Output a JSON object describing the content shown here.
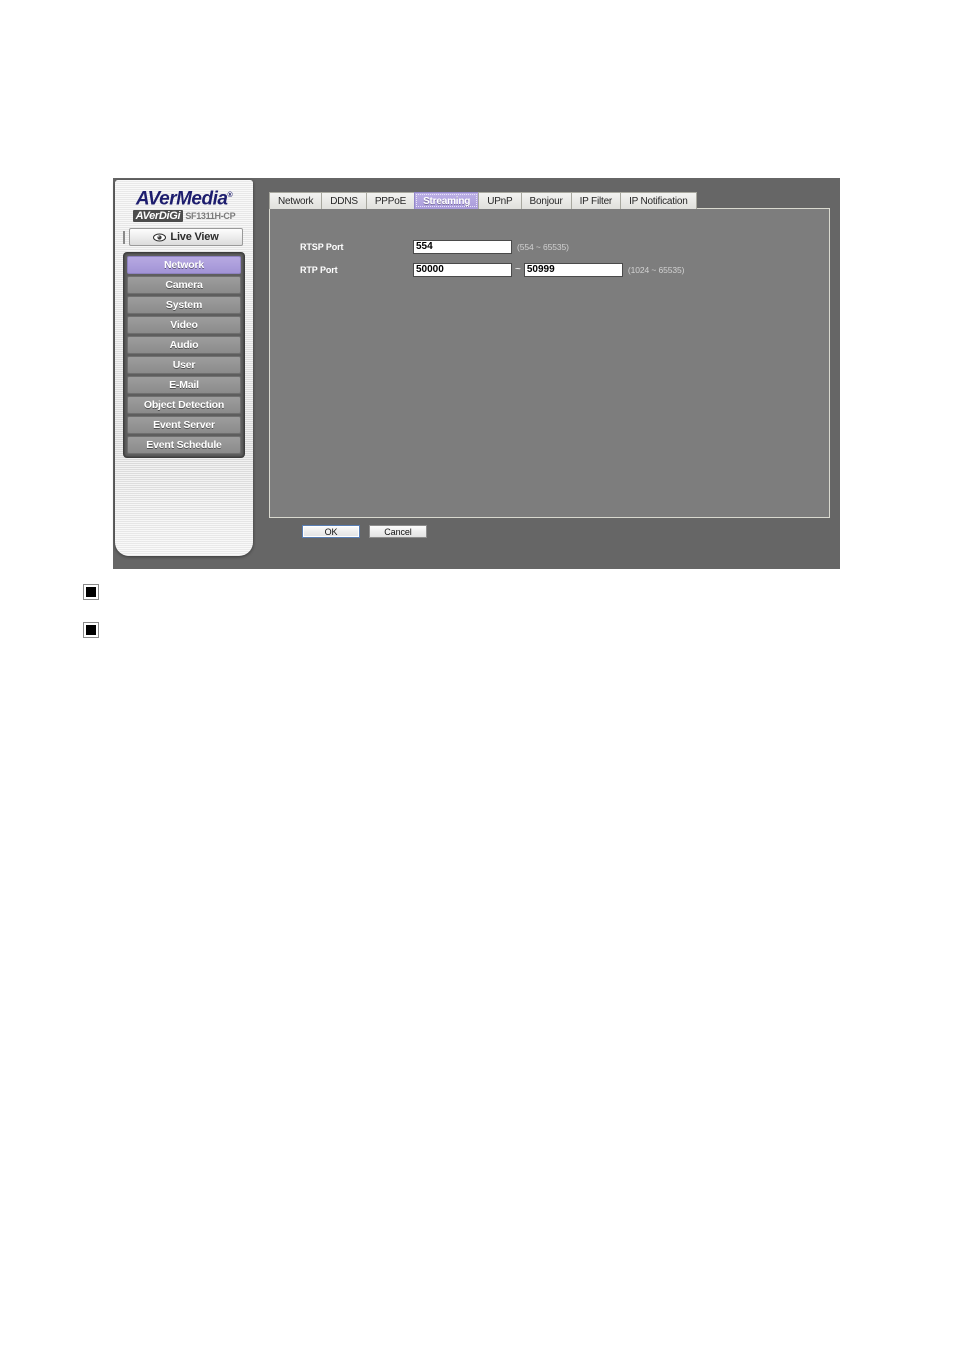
{
  "product": {
    "brand": "AVerMedia",
    "brand_mark": "®",
    "digi_label": "AVerDiGi",
    "model": "SF1311H-CP"
  },
  "sidebar": {
    "live_view": {
      "label": "Live View",
      "icon": "eye-icon"
    },
    "items": [
      {
        "label": "Network",
        "active": true
      },
      {
        "label": "Camera",
        "active": false
      },
      {
        "label": "System",
        "active": false
      },
      {
        "label": "Video",
        "active": false
      },
      {
        "label": "Audio",
        "active": false
      },
      {
        "label": "User",
        "active": false
      },
      {
        "label": "E-Mail",
        "active": false
      },
      {
        "label": "Object Detection",
        "active": false
      },
      {
        "label": "Event Server",
        "active": false
      },
      {
        "label": "Event Schedule",
        "active": false
      }
    ]
  },
  "tabs": [
    {
      "label": "Network",
      "active": false
    },
    {
      "label": "DDNS",
      "active": false
    },
    {
      "label": "PPPoE",
      "active": false
    },
    {
      "label": "Streaming",
      "active": true
    },
    {
      "label": "UPnP",
      "active": false
    },
    {
      "label": "Bonjour",
      "active": false
    },
    {
      "label": "IP Filter",
      "active": false
    },
    {
      "label": "IP Notification",
      "active": false
    }
  ],
  "form": {
    "rtsp": {
      "label": "RTSP Port",
      "value": "554",
      "hint": "(554 ~ 65535)"
    },
    "rtp": {
      "label": "RTP Port",
      "value_start": "50000",
      "separator": "~",
      "value_end": "50999",
      "hint": "(1024 ~ 65535)"
    }
  },
  "footer": {
    "ok_label": "OK",
    "cancel_label": "Cancel"
  },
  "colors": {
    "accent_purple": "#a99bda",
    "window_gray": "#666666",
    "panel_gray": "#7d7d7d",
    "logo_navy": "#1d1d6e"
  },
  "bullets": [
    {
      "text": ""
    },
    {
      "text": ""
    }
  ]
}
